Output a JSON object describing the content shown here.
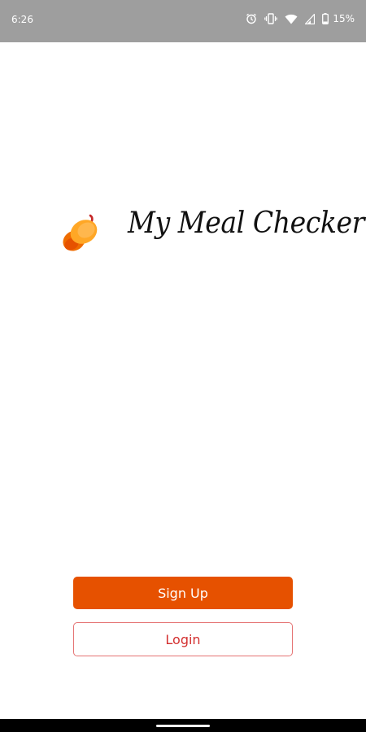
{
  "status_bar": {
    "time": "6:26",
    "battery_percent": "15%",
    "icons": [
      "alarm-icon",
      "vibrate-icon",
      "wifi-icon",
      "signal-icon",
      "battery-icon"
    ]
  },
  "app": {
    "title": "My Meal Checker",
    "logo_icon": "acorn-icon",
    "accent_color": "#e65100"
  },
  "buttons": {
    "signup_label": "Sign Up",
    "login_label": "Login"
  }
}
